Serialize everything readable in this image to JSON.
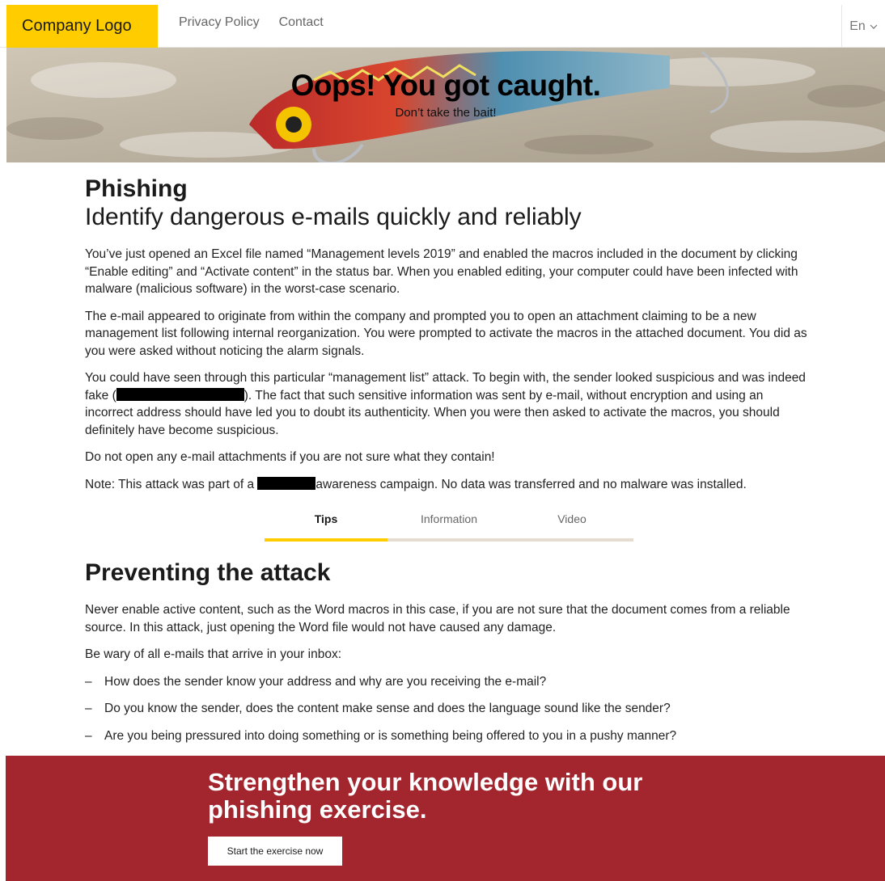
{
  "header": {
    "logo": "Company Logo",
    "nav": [
      "Privacy Policy",
      "Contact"
    ],
    "language": "En"
  },
  "hero": {
    "title": "Oops! You got caught.",
    "subtitle": "Don’t take the bait!"
  },
  "main": {
    "heading": "Phishing",
    "subheading": "Identify dangerous e-mails quickly and reliably",
    "p1": "You’ve just opened an Excel file named “Management levels 2019” and enabled the macros included in the document by clicking “Enable editing” and “Activate content” in the status bar. When you enabled editing, your computer could have been infected with malware (malicious software) in the worst-case scenario.",
    "p2": "The e-mail appeared to originate from within the company and prompted you to open an attachment claiming to be a new management list following internal reorganization. You were prompted to activate the macros in the attached document. You did as you were asked without noticing the alarm signals.",
    "p3_part1": "You could have seen through this particular “management list” attack. To begin with, the sender looked suspicious and was indeed fake (",
    "p3_part2": "). The fact that such sensitive information was sent by e-mail, without encryption and using an incorrect address should have led you to doubt its authenticity. When you were then asked to activate the macros, you should definitely have become suspicious.",
    "p4": "Do not open any e-mail attachments if you are not sure what they contain!",
    "p5_part1": "Note: This attack was part of a ",
    "p5_part2": "awareness campaign. No data was transferred and no malware was installed."
  },
  "tabs": [
    {
      "label": "Tips",
      "active": true
    },
    {
      "label": "Information",
      "active": false
    },
    {
      "label": "Video",
      "active": false
    }
  ],
  "prevent": {
    "heading": "Preventing the attack",
    "p1": "Never enable active content, such as the Word macros in this case, if you are not sure that the document comes from a reliable source. In this attack, just opening the Word file would not have caused any damage.",
    "p2": "Be wary of all e-mails that arrive in your inbox:",
    "bullets": [
      "How does the sender know your address and why are you receiving the e-mail?",
      "Do you know the sender, does the content make sense and does the language sound like the sender?",
      "Are you being pressured into doing something or is something being offered to you in a pushy manner?"
    ],
    "dash": "–"
  },
  "banner": {
    "title": "Strengthen your knowledge with our phishing exercise.",
    "button": "Start the exercise now"
  },
  "colors": {
    "accent_yellow": "#ffcc00",
    "banner_red": "#a3262f",
    "tab_track": "#e4ddd0"
  },
  "icons": {
    "language_dropdown": "chevron-down-icon",
    "hero_image": "fishing-lure-image"
  }
}
